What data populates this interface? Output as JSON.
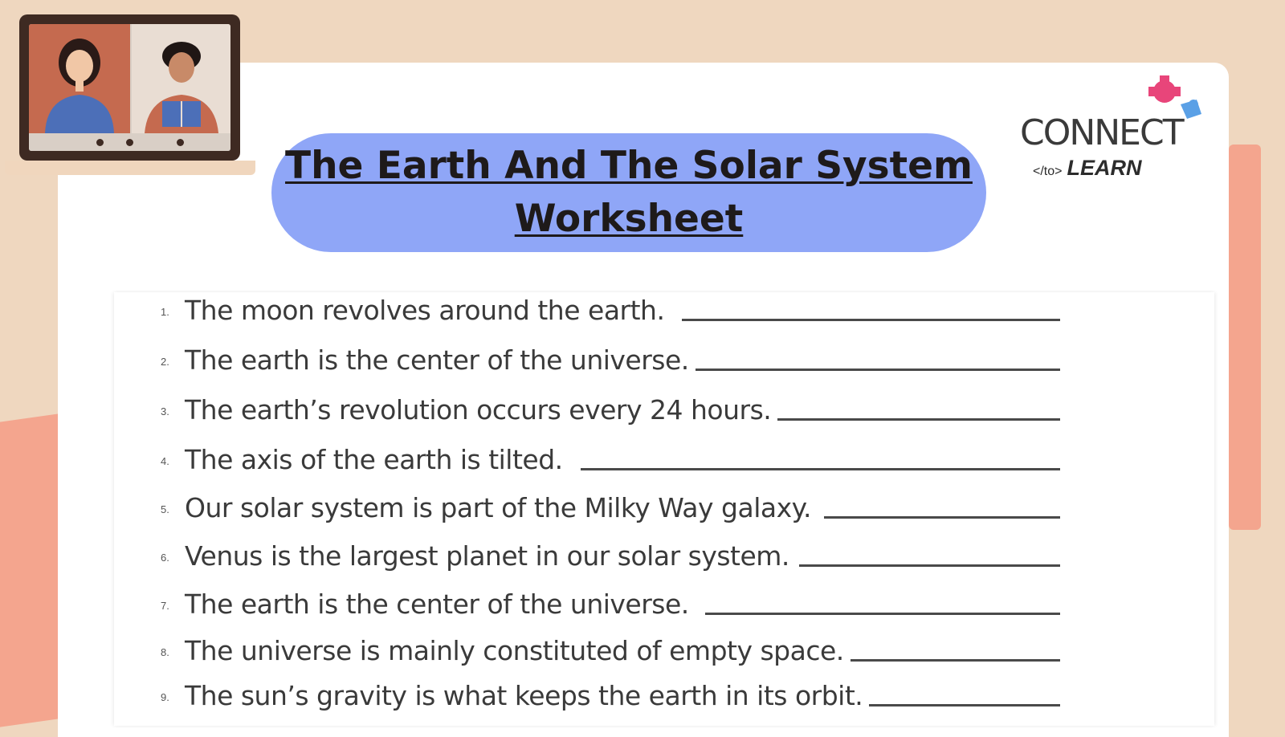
{
  "title": {
    "line1": "The Earth And The Solar System",
    "line2": "Worksheet"
  },
  "logo": {
    "word": "CONNECT",
    "tag": "</to>",
    "sub": "LEARN"
  },
  "questions": [
    {
      "num": "1.",
      "text": "The moon revolves around the earth."
    },
    {
      "num": "2.",
      "text": "The earth is the center of the universe."
    },
    {
      "num": "3.",
      "text": "The earth’s revolution occurs every 24 hours."
    },
    {
      "num": "4.",
      "text": "The axis of the earth is tilted."
    },
    {
      "num": "5.",
      "text": "Our solar system is part of the Milky Way galaxy."
    },
    {
      "num": "6.",
      "text": "Venus is the largest planet in our solar system."
    },
    {
      "num": "7.",
      "text": "The earth is the center of the universe."
    },
    {
      "num": "8.",
      "text": "The universe is mainly constituted of empty space."
    },
    {
      "num": "9.",
      "text": "The sun’s gravity is what keeps the earth in its orbit."
    }
  ],
  "colors": {
    "background": "#efd7bf",
    "accent_salmon": "#f4a58e",
    "title_pill": "#8fa6f7",
    "logo_magenta": "#e8457a",
    "logo_blue": "#5aa0e6"
  }
}
